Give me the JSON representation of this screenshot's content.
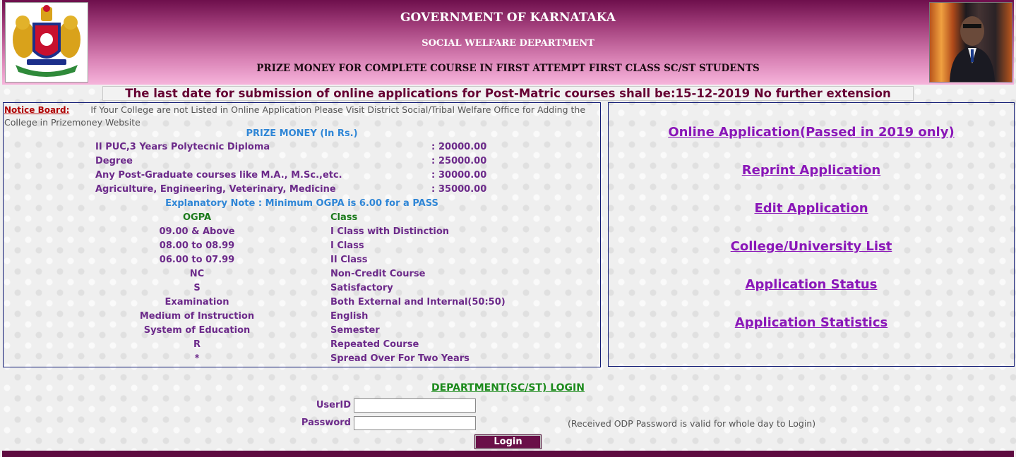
{
  "header": {
    "title": "GOVERNMENT OF KARNATAKA",
    "department": "SOCIAL WELFARE DEPARTMENT",
    "scheme": "PRIZE MONEY FOR COMPLETE COURSE IN FIRST ATTEMPT FIRST CLASS SC/ST STUDENTS",
    "emblem_icon": "karnataka-emblem-icon",
    "portrait_icon": "ambedkar-portrait-icon"
  },
  "banner": "The last date for submission of online applications for Post-Matric courses shall be:15-12-2019 No further extension",
  "notice": {
    "label": "Notice Board:",
    "text": "If Your College are not Listed in Online Application Please Visit District Social/Tribal  Welfare Office for Adding the College in Prizemoney Website"
  },
  "prize": {
    "heading": "PRIZE MONEY (In Rs.)",
    "rows": [
      {
        "course": "II PUC,3 Years Polytecnic Diploma",
        "amount": "20000.00"
      },
      {
        "course": "Degree",
        "amount": "25000.00"
      },
      {
        "course": "Any Post-Graduate courses like M.A., M.Sc.,etc.",
        "amount": "30000.00"
      },
      {
        "course": "Agriculture, Engineering, Veterinary, Medicine",
        "amount": "35000.00"
      }
    ],
    "separator": ":"
  },
  "explanatory_note": "Explanatory Note : Minimum OGPA is 6.00 for a PASS",
  "grading": {
    "headers": {
      "ogpa": "OGPA",
      "class": "Class"
    },
    "rows": [
      {
        "ogpa": "09.00 & Above",
        "class": "I Class with Distinction"
      },
      {
        "ogpa": "08.00 to 08.99",
        "class": "I Class"
      },
      {
        "ogpa": "06.00 to 07.99",
        "class": "II Class"
      },
      {
        "ogpa": "NC",
        "class": "Non-Credit Course"
      },
      {
        "ogpa": "S",
        "class": "Satisfactory"
      },
      {
        "ogpa": "Examination",
        "class": "Both External and Internal(50:50)"
      },
      {
        "ogpa": "Medium of Instruction",
        "class": "English"
      },
      {
        "ogpa": "System of Education",
        "class": "Semester"
      },
      {
        "ogpa": "R",
        "class": "Repeated Course"
      },
      {
        "ogpa": "*",
        "class": "Spread Over For Two Years"
      }
    ]
  },
  "links": [
    "Online Application(Passed in 2019 only)",
    "Reprint Application",
    "Edit Application",
    "College/University List",
    "Application Status",
    "Application Statistics"
  ],
  "login": {
    "title": "DEPARTMENT(SC/ST) LOGIN",
    "userid_label": "UserID",
    "password_label": "Password",
    "userid_value": "",
    "password_value": "",
    "note": "(Received ODP Password is valid for whole day to Login)",
    "button": "Login"
  },
  "colors": {
    "header_dark": "#6e0f4c",
    "header_light": "#f6b4db",
    "banner_text": "#660033",
    "link": "#8a16b8",
    "label_purple": "#6c2a8a",
    "blue_heading": "#2f86d6",
    "login_green": "#1b8a1b"
  }
}
